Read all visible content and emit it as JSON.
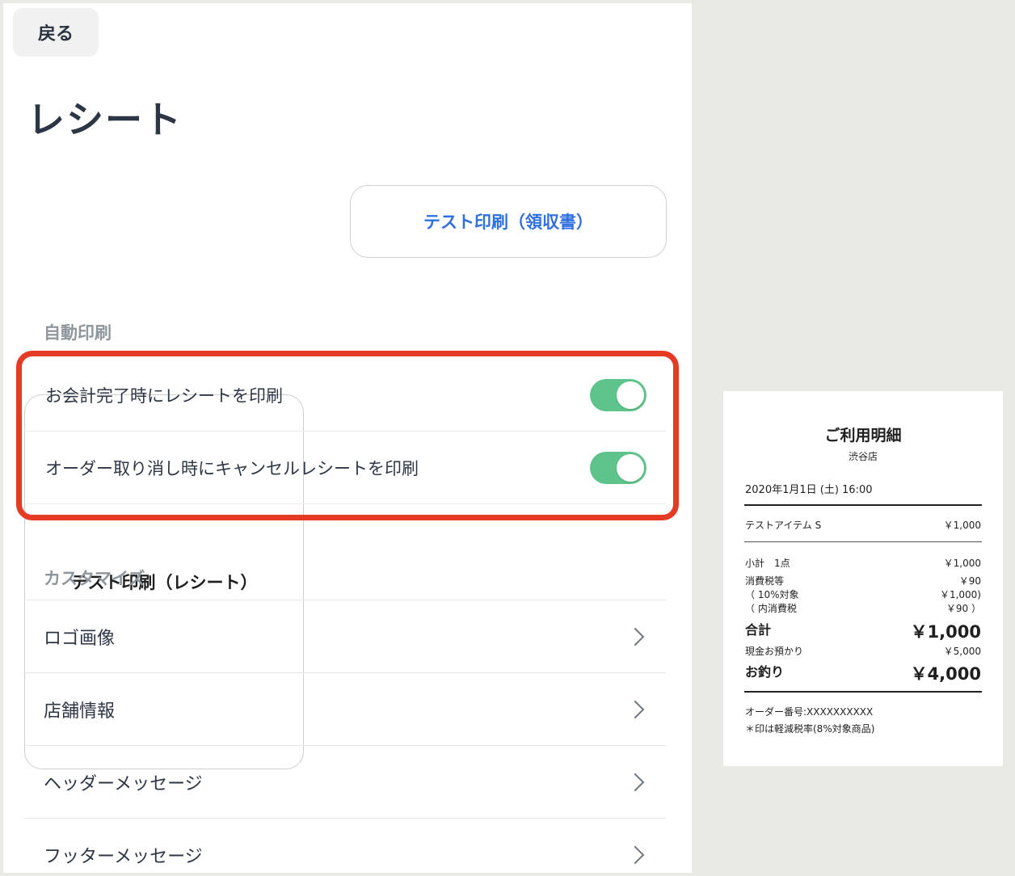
{
  "back_label": "戻る",
  "title": "レシート",
  "test_buttons": {
    "receipt": "テスト印刷（レシート）",
    "invoice": "テスト印刷（領収書）"
  },
  "sections": {
    "auto_print": "自動印刷",
    "customize": "カスタマイズ"
  },
  "toggles": [
    {
      "label": "お会計完了時にレシートを印刷",
      "on": true
    },
    {
      "label": "オーダー取り消し時にキャンセルレシートを印刷",
      "on": true
    }
  ],
  "menu": [
    {
      "label": "ロゴ画像"
    },
    {
      "label": "店舗情報"
    },
    {
      "label": "ヘッダーメッセージ"
    },
    {
      "label": "フッターメッセージ"
    }
  ],
  "colors": {
    "accent_blue": "#2f6fe0",
    "toggle_green": "#5fc48b",
    "highlight_red": "#e53b24"
  },
  "receipt": {
    "title": "ご利用明細",
    "store": "渋谷店",
    "datetime": "2020年1月1日 (土) 16:00",
    "item": {
      "name": "テストアイテム S",
      "price": "￥1,000"
    },
    "subtotal": {
      "label": "小計　1点",
      "value": "￥1,000"
    },
    "tax": {
      "label": "消費税等",
      "value": "￥90"
    },
    "tax_target": {
      "label": "（ 10%対象",
      "value": "￥1,000)"
    },
    "tax_included": {
      "label": "（ 内消費税",
      "value": "￥90 ）"
    },
    "total": {
      "label": "合計",
      "value": "￥1,000"
    },
    "cash": {
      "label": "現金お預かり",
      "value": "￥5,000"
    },
    "change": {
      "label": "お釣り",
      "value": "￥4,000"
    },
    "order_no": "オーダー番号:XXXXXXXXXX",
    "note": "＊印は軽減税率(8%対象商品)"
  }
}
